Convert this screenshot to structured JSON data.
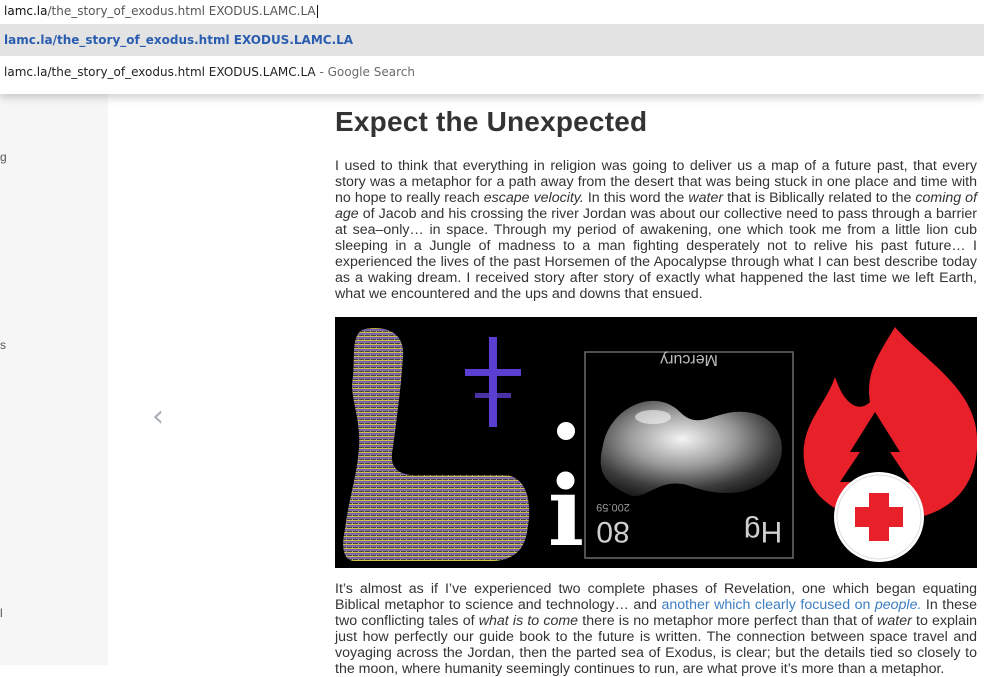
{
  "omnibox": {
    "input_host": "lamc.la",
    "input_path": "/the_story_of_exodus.html EXODUS.LAMC.LA",
    "suggestion_url": "lamc.la/the_story_of_exodus.html EXODUS.LAMC.LA",
    "suggestion_search_text": "lamc.la/the_story_of_exodus.html EXODUS.LAMC.LA",
    "suggestion_search_suffix": " - Google Search"
  },
  "left_panel": {
    "fragments": [
      "g",
      "s",
      "l"
    ]
  },
  "article": {
    "title": "Expect the Unexpected",
    "p1": {
      "t1": "I used to think that everything in religion was going to deliver us a map of a future past, that every story was a metaphor for a path away from the desert that was being stuck in one place and time with no hope to really reach ",
      "e1": "escape velocity.",
      "t2": " In this word the ",
      "e2": "water",
      "t3": " that is Biblically related to the ",
      "e3": "coming of age",
      "t4": " of Jacob and his crossing the river Jordan was about our collective need to pass through a barrier at sea–only… in space. Through my period of awakening, one which took me from a little lion cub sleeping in a Jungle of madness to a man fighting desperately not to relive his past future… I experienced the lives of the past Horsemen of the Apocalypse through what I can best describe today as a waking dream. I received story after story of exactly what happened the last time we left Earth, what we encountered and the ups and downs that ensued."
    },
    "figure": {
      "element_label": "Mercury",
      "element_symbol": "Hg",
      "atomic_number": "80",
      "atomic_mass": "200.59",
      "letter": "i"
    },
    "p2": {
      "t1": "It’s almost as if I’ve experienced two complete phases of Revelation, one which began equating Biblical metaphor to science and technology… and ",
      "link": "another which clearly focused on ",
      "link_em": "people.",
      "t2": " In these two conflicting tales of ",
      "e1": "what is to come",
      "t3": " there is no metaphor more perfect than that of ",
      "e2": "water",
      "t4": " to explain just how perfectly our guide book to the future is written. The connection between space travel and voyaging across the Jordan, then the parted sea of Exodus, is clear; but the details tied so closely to the moon, where humanity seemingly continues to run, are what prove it’s more than a metaphor."
    }
  },
  "nav": {
    "prev_glyph": "‹"
  },
  "colors": {
    "link": "#3d7ec1",
    "suggest_url": "#2a5db0",
    "fire": "#e8202a"
  }
}
